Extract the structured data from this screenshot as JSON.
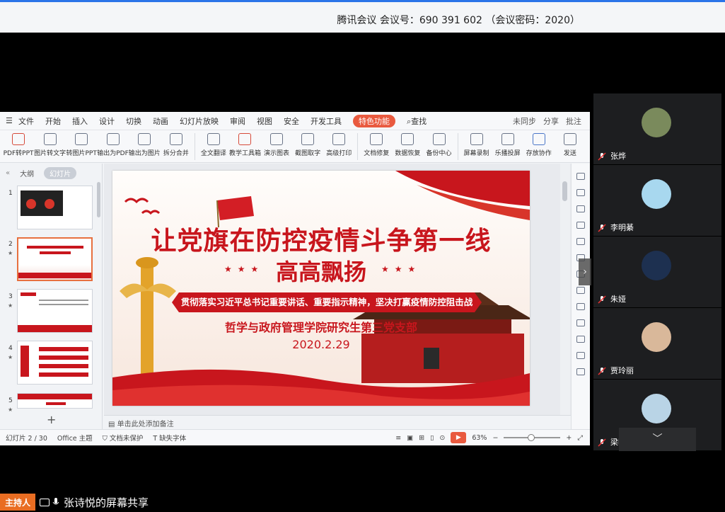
{
  "meeting": {
    "info": "腾讯会议 会议号：690 391 602 （会议密码：2020）",
    "host_badge": "主持人",
    "share_label": "张诗悦的屏幕共享",
    "collapse_symbol": "﹀",
    "side_arrow": "›"
  },
  "wps": {
    "menu": {
      "file": "文件",
      "items": [
        "开始",
        "插入",
        "设计",
        "切换",
        "动画",
        "幻灯片放映",
        "审阅",
        "视图",
        "安全",
        "开发工具"
      ],
      "special": "特色功能",
      "search": "查找",
      "right": [
        "未同步",
        "分享",
        "批注"
      ]
    },
    "ribbon": [
      {
        "label": "PDF转PPT",
        "icon": "pdf-to-ppt-icon"
      },
      {
        "label": "图片转文字",
        "icon": "image-to-text-icon"
      },
      {
        "label": "转图片PPT",
        "icon": "to-image-ppt-icon"
      },
      {
        "label": "输出为PDF",
        "icon": "export-pdf-icon"
      },
      {
        "label": "输出为图片",
        "icon": "export-image-icon"
      },
      {
        "label": "拆分合并",
        "icon": "split-merge-icon"
      },
      {
        "label": "全文翻译",
        "icon": "translate-icon"
      },
      {
        "label": "教学工具箱",
        "icon": "teaching-tools-icon"
      },
      {
        "label": "演示图表",
        "icon": "demo-chart-icon"
      },
      {
        "label": "截图取字",
        "icon": "screenshot-text-icon"
      },
      {
        "label": "高级打印",
        "icon": "advanced-print-icon"
      },
      {
        "label": "文档修复",
        "icon": "doc-repair-icon"
      },
      {
        "label": "数据恢复",
        "icon": "data-recovery-icon"
      },
      {
        "label": "备份中心",
        "icon": "backup-center-icon"
      },
      {
        "label": "屏幕录制",
        "icon": "screen-record-icon"
      },
      {
        "label": "乐播投屏",
        "icon": "cast-screen-icon"
      },
      {
        "label": "存放协作",
        "icon": "collab-icon"
      },
      {
        "label": "发送",
        "icon": "send-icon"
      }
    ],
    "left_tabs": {
      "outline": "大纲",
      "slides": "幻灯片",
      "collapse": "«"
    },
    "thumbnails": [
      {
        "num": "1",
        "star": ""
      },
      {
        "num": "2",
        "star": "★"
      },
      {
        "num": "3",
        "star": "★"
      },
      {
        "num": "4",
        "star": "★"
      },
      {
        "num": "5",
        "star": "★"
      }
    ],
    "add_slide": "+",
    "slide": {
      "title1": "让党旗在防控疫情斗争第一线",
      "title2": "高高飘扬",
      "stars": "★★★",
      "banner": "贯彻落实习近平总书记重要讲话、重要指示精神，坚决打赢疫情防控阻击战",
      "org": "哲学与政府管理学院研究生第三党支部",
      "date": "2020.2.29"
    },
    "notes_placeholder": "单击此处添加备注",
    "status": {
      "slide_count": "幻灯片 2 / 30",
      "theme": "Office 主题",
      "protection": "文档未保护",
      "font": "缺失字体",
      "zoom": "63%"
    }
  },
  "participants": [
    {
      "name": "张烨",
      "avatar_color": "#7a8a5c"
    },
    {
      "name": "李明綦",
      "avatar_color": "#a8d8ef"
    },
    {
      "name": "朱娅",
      "avatar_color": "#1d3050"
    },
    {
      "name": "贾玲丽",
      "avatar_color": "#d9b89a"
    },
    {
      "name": "梁明明",
      "avatar_color": "#b9d4e6"
    }
  ],
  "colors": {
    "accent_red": "#c8161d",
    "host_orange": "#e96d22",
    "wps_orange": "#e95a3f"
  }
}
